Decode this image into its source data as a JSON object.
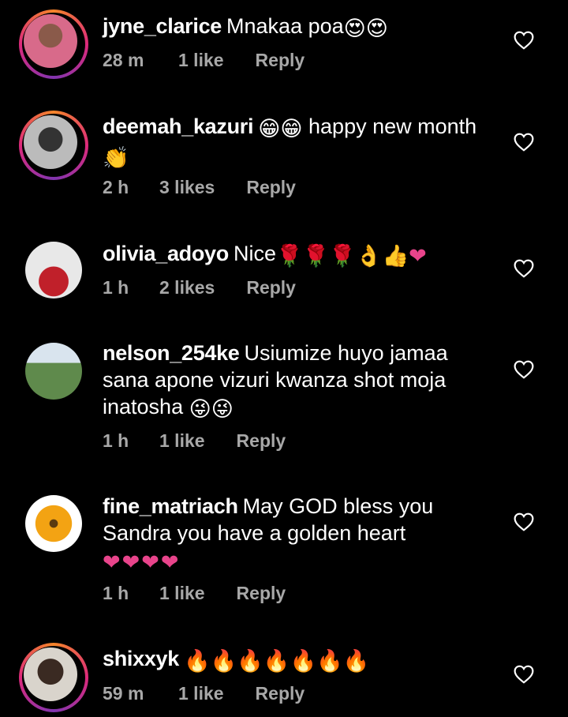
{
  "comments": [
    {
      "username": "jyne_clarice",
      "text": "Mnakaa poa",
      "emoji": "😍😍",
      "time": "28 m",
      "likes": "1 like",
      "reply": "Reply"
    },
    {
      "username": "deemah_kazuri",
      "text": "happy new month",
      "emoji_before": "😁😁",
      "emoji_after": "👏",
      "time": "2 h",
      "likes": "3 likes",
      "reply": "Reply"
    },
    {
      "username": "olivia_adoyo",
      "text": "Nice",
      "emoji": "🌹🌹🌹👌👍❤",
      "time": "1 h",
      "likes": "2 likes",
      "reply": "Reply"
    },
    {
      "username": "nelson_254ke",
      "text": "Usiumize huyo jamaa sana apone vizuri kwanza shot moja inatosha",
      "emoji": "😜😜",
      "time": "1 h",
      "likes": "1 like",
      "reply": "Reply"
    },
    {
      "username": "fine_matriach",
      "text": "May GOD bless you Sandra you have a golden heart",
      "emoji": "❤❤❤❤",
      "time": "1 h",
      "likes": "1 like",
      "reply": "Reply"
    },
    {
      "username": "shixxyk",
      "text": "",
      "emoji": "🔥🔥🔥🔥🔥🔥🔥",
      "time": "59 m",
      "likes": "1 like",
      "reply": "Reply"
    }
  ],
  "colors": {
    "background": "#000000",
    "meta": "#a8a8a8",
    "heart_emoji": "#e8448b",
    "story_ring": "#dd2a7b"
  },
  "icons": {
    "like": "heart-outline-icon"
  }
}
